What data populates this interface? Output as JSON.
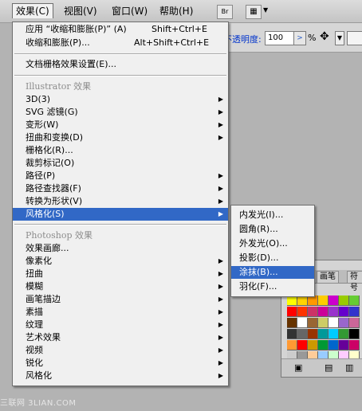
{
  "menubar": {
    "items": [
      "效果(C)",
      "视图(V)",
      "窗口(W)",
      "帮助(H)"
    ],
    "br_label": "Br"
  },
  "control_bar": {
    "opacity_label": "不透明度:",
    "opacity_value": "100",
    "percent": "%"
  },
  "menu": {
    "apply_last": {
      "label": "应用 “收缩和膨胀(P)” (A)",
      "shortcut": "Shift+Ctrl+E"
    },
    "last_effect": {
      "label": "收缩和膨胀(P)...",
      "shortcut": "Alt+Shift+Ctrl+E"
    },
    "doc_raster": "文档栅格效果设置(E)...",
    "illustrator_header": "Illustrator 效果",
    "illustrator_items": [
      "3D(3)",
      "SVG 滤镜(G)",
      "变形(W)",
      "扭曲和变换(D)",
      "栅格化(R)...",
      "裁剪标记(O)",
      "路径(P)",
      "路径查找器(F)",
      "转换为形状(V)",
      "风格化(S)"
    ],
    "photoshop_header": "Photoshop 效果",
    "photoshop_items": [
      "效果画廊...",
      "像素化",
      "扭曲",
      "模糊",
      "画笔描边",
      "素描",
      "纹理",
      "艺术效果",
      "视频",
      "锐化",
      "风格化"
    ]
  },
  "submenu": {
    "items": [
      "内发光(I)...",
      "圆角(R)...",
      "外发光(O)...",
      "投影(D)...",
      "涂抹(B)...",
      "羽化(F)..."
    ]
  },
  "swatch_panel": {
    "tabs": [
      "画笔",
      "符号"
    ]
  },
  "watermark": "三联网 3LIAN.COM",
  "colors": {
    "highlight": "#3168c6",
    "menu_bg": "#f0f0f0",
    "disabled_header": "#8c8c8c"
  }
}
